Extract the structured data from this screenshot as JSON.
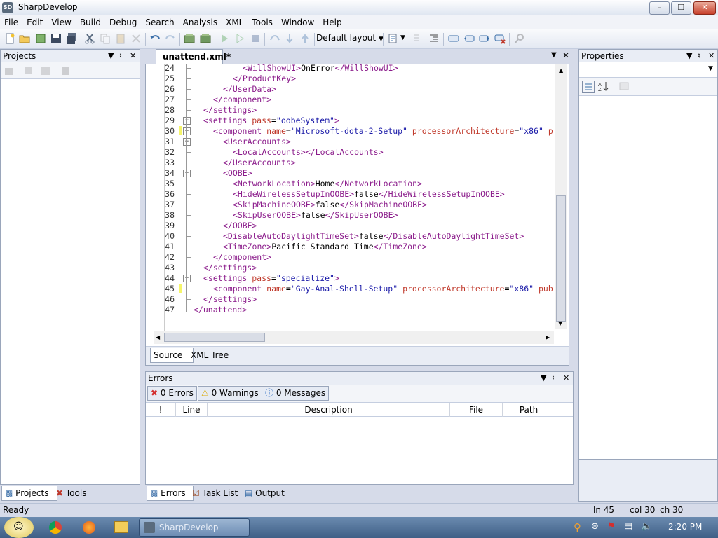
{
  "window": {
    "title": "SharpDevelop",
    "app_icon_text": "SD"
  },
  "menu": [
    "File",
    "Edit",
    "View",
    "Build",
    "Debug",
    "Search",
    "Analysis",
    "XML",
    "Tools",
    "Window",
    "Help"
  ],
  "toolbar": {
    "layout_label": "Default layout"
  },
  "projects_panel": {
    "title": "Projects",
    "tabs": [
      "Projects",
      "Tools"
    ]
  },
  "properties_panel": {
    "title": "Properties"
  },
  "editor": {
    "tab_title": "unattend.xml*",
    "bottom_tabs": [
      "Source",
      "XML Tree"
    ],
    "lines": [
      {
        "n": "24",
        "html": "<span class=\"t\">&lt;WillShowUI&gt;</span>OnError<span class=\"t\">&lt;/WillShowUI&gt;</span>",
        "indent": 8
      },
      {
        "n": "25",
        "html": "<span class=\"t\">&lt;/ProductKey&gt;</span>",
        "indent": 6
      },
      {
        "n": "26",
        "html": "<span class=\"t\">&lt;/UserData&gt;</span>",
        "indent": 4
      },
      {
        "n": "27",
        "html": "<span class=\"t\">&lt;/component&gt;</span>",
        "indent": 2
      },
      {
        "n": "28",
        "html": "<span class=\"t\">&lt;/settings&gt;</span>",
        "indent": 0
      },
      {
        "n": "29",
        "html": "<span class=\"t\">&lt;settings </span><span class=\"a\">pass</span>=<span class=\"s\">\"oobeSystem\"</span><span class=\"t\">&gt;</span>",
        "indent": 0
      },
      {
        "n": "30",
        "html": "<span class=\"t\">&lt;component </span><span class=\"a\">name</span>=<span class=\"s\">\"Microsoft-dota-2-Setup\"</span> <span class=\"a\">processorArchitecture</span>=<span class=\"s\">\"x86\"</span> <span class=\"a\">p</span>",
        "indent": 2
      },
      {
        "n": "31",
        "html": "<span class=\"t\">&lt;UserAccounts&gt;</span>",
        "indent": 4
      },
      {
        "n": "32",
        "html": "<span class=\"t\">&lt;LocalAccounts&gt;&lt;/LocalAccounts&gt;</span>",
        "indent": 6
      },
      {
        "n": "33",
        "html": "<span class=\"t\">&lt;/UserAccounts&gt;</span>",
        "indent": 4
      },
      {
        "n": "34",
        "html": "<span class=\"t\">&lt;OOBE&gt;</span>",
        "indent": 4
      },
      {
        "n": "35",
        "html": "<span class=\"t\">&lt;NetworkLocation&gt;</span>Home<span class=\"t\">&lt;/NetworkLocation&gt;</span>",
        "indent": 6
      },
      {
        "n": "36",
        "html": "<span class=\"t\">&lt;HideWirelessSetupInOOBE&gt;</span>false<span class=\"t\">&lt;/HideWirelessSetupInOOBE&gt;</span>",
        "indent": 6
      },
      {
        "n": "37",
        "html": "<span class=\"t\">&lt;SkipMachineOOBE&gt;</span>false<span class=\"t\">&lt;/SkipMachineOOBE&gt;</span>",
        "indent": 6
      },
      {
        "n": "38",
        "html": "<span class=\"t\">&lt;SkipUserOOBE&gt;</span>false<span class=\"t\">&lt;/SkipUserOOBE&gt;</span>",
        "indent": 6
      },
      {
        "n": "39",
        "html": "<span class=\"t\">&lt;/OOBE&gt;</span>",
        "indent": 4
      },
      {
        "n": "40",
        "html": "<span class=\"t\">&lt;DisableAutoDaylightTimeSet&gt;</span>false<span class=\"t\">&lt;/DisableAutoDaylightTimeSet&gt;</span>",
        "indent": 4
      },
      {
        "n": "41",
        "html": "<span class=\"t\">&lt;TimeZone&gt;</span>Pacific Standard Time<span class=\"t\">&lt;/TimeZone&gt;</span>",
        "indent": 4
      },
      {
        "n": "42",
        "html": "<span class=\"t\">&lt;/component&gt;</span>",
        "indent": 2
      },
      {
        "n": "43",
        "html": "<span class=\"t\">&lt;/settings&gt;</span>",
        "indent": 0
      },
      {
        "n": "44",
        "html": "<span class=\"t\">&lt;settings </span><span class=\"a\">pass</span>=<span class=\"s\">\"specialize\"</span><span class=\"t\">&gt;</span>",
        "indent": 0
      },
      {
        "n": "45",
        "html": "<span class=\"t\">&lt;component </span><span class=\"a\">name</span>=<span class=\"s\">\"Gay-Anal-Shell-Setup\"</span> <span class=\"a\">processorArchitecture</span>=<span class=\"s\">\"x86\"</span> <span class=\"a\">pub</span>",
        "indent": 2
      },
      {
        "n": "46",
        "html": "<span class=\"t\">&lt;/settings&gt;</span>",
        "indent": 0
      },
      {
        "n": "47",
        "html": "<span class=\"t\">&lt;/unattend&gt;</span>",
        "indent": -2
      }
    ]
  },
  "errors_panel": {
    "title": "Errors",
    "filters": [
      "0 Errors",
      "0 Warnings",
      "0 Messages"
    ],
    "columns": [
      "!",
      "Line",
      "Description",
      "File",
      "Path"
    ],
    "bottom_tabs": [
      "Errors",
      "Task List",
      "Output"
    ]
  },
  "statusbar": {
    "left": "Ready",
    "line": "ln 45",
    "col": "col 30",
    "ch": "ch 30"
  },
  "taskbar": {
    "active_app": "SharpDevelop",
    "clock": "2:20 PM"
  }
}
